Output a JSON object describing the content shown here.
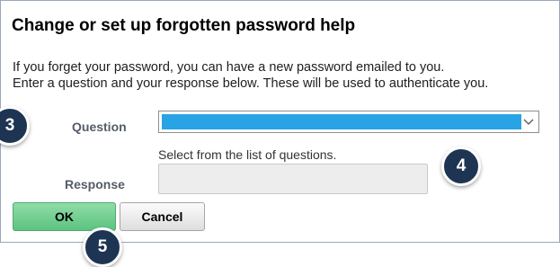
{
  "page": {
    "title": "Change or set up forgotten password help",
    "instruction_line1": "If you forget your password, you can have a new password emailed to you.",
    "instruction_line2": "Enter a question and your response below. These will be used to authenticate you."
  },
  "form": {
    "question_label": "Question",
    "question_selected_value": "",
    "question_hint": "Select from the list of questions.",
    "response_label": "Response",
    "response_value": ""
  },
  "buttons": {
    "ok_label": "OK",
    "cancel_label": "Cancel"
  },
  "step_badges": [
    "3",
    "4",
    "5"
  ],
  "colors": {
    "select_highlight": "#28a4e4",
    "ok_button": "#6fcf8f",
    "badge": "#1e3453"
  },
  "icons": {
    "dropdown": "chevron-down-icon"
  }
}
